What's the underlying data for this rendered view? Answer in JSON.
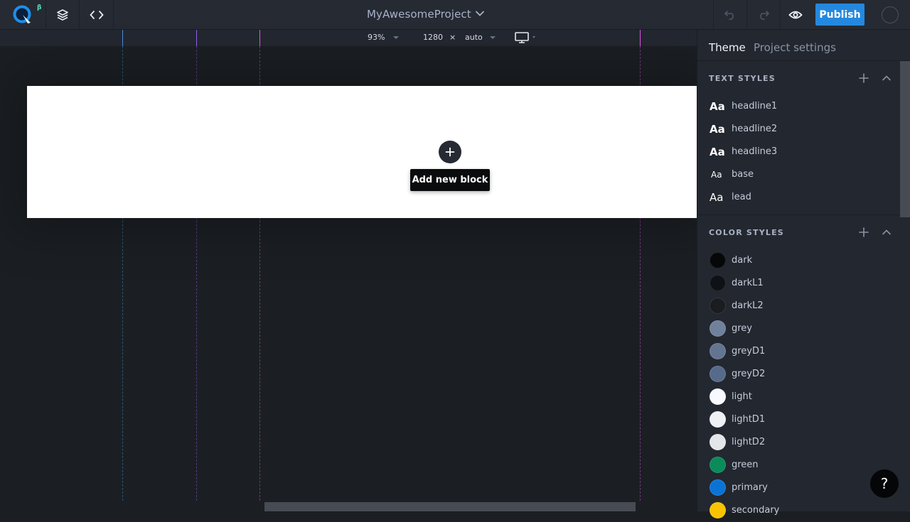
{
  "topbar": {
    "logo_badge": "β",
    "project_name": "MyAwesomeProject",
    "publish_label": "Publish"
  },
  "ruler": {
    "zoom": "93%",
    "width": "1280",
    "times": "×",
    "height": "auto",
    "device": "desktop-icon"
  },
  "canvas": {
    "add_block_label": "Add new block",
    "breakpoint_colors": [
      "#4a8fe0",
      "#9a5cf0",
      "#e356e8",
      "#e356e8"
    ]
  },
  "sidebar": {
    "tabs": [
      {
        "label": "Theme",
        "active": true
      },
      {
        "label": "Project settings",
        "active": false
      }
    ],
    "text_styles": {
      "title": "TEXT STYLES",
      "items": [
        {
          "glyph": "Aa",
          "label": "headline1"
        },
        {
          "glyph": "Aa",
          "label": "headline2"
        },
        {
          "glyph": "Aa",
          "label": "headline3"
        },
        {
          "glyph": "Aa",
          "label": "base"
        },
        {
          "glyph": "Aa",
          "label": "lead"
        }
      ]
    },
    "color_styles": {
      "title": "COLOR STYLES",
      "items": [
        {
          "label": "dark",
          "color": "#050709"
        },
        {
          "label": "darkL1",
          "color": "#0e1115"
        },
        {
          "label": "darkL2",
          "color": "#1a1c20"
        },
        {
          "label": "grey",
          "color": "#6f819b"
        },
        {
          "label": "greyD1",
          "color": "#637590"
        },
        {
          "label": "greyD2",
          "color": "#566a89"
        },
        {
          "label": "light",
          "color": "#f7f9fe"
        },
        {
          "label": "lightD1",
          "color": "#eef0f4"
        },
        {
          "label": "lightD2",
          "color": "#e3e5e9"
        },
        {
          "label": "green",
          "color": "#0b8a5a"
        },
        {
          "label": "primary",
          "color": "#0a73d4"
        },
        {
          "label": "secondary",
          "color": "#f9c300"
        }
      ]
    }
  },
  "help": {
    "label": "?"
  }
}
